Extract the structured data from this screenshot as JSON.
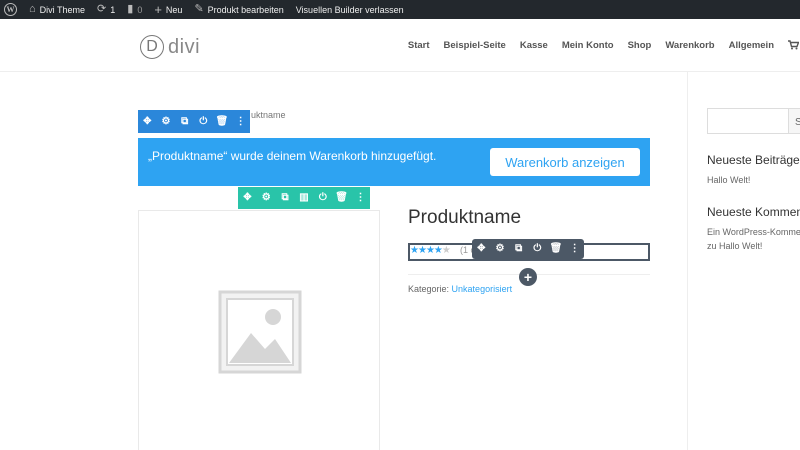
{
  "admin_bar": {
    "site_name": "Divi Theme",
    "updates_count": "1",
    "comments_count": "0",
    "new_label": "Neu",
    "edit_product_label": "Produkt bearbeiten",
    "exit_builder_label": "Visuellen Builder verlassen"
  },
  "header": {
    "logo_mark": "D",
    "logo_text": "divi",
    "nav": [
      "Start",
      "Beispiel-Seite",
      "Kasse",
      "Mein Konto",
      "Shop",
      "Warenkorb",
      "Allgemein"
    ]
  },
  "breadcrumb": "uktname",
  "notice": {
    "text": "„Produktname“ wurde deinem Warenkorb hinzugefügt.",
    "button_label": "Warenkorb anzeigen"
  },
  "product": {
    "title": "Produktname",
    "rating": 4,
    "rating_max": 5,
    "review_count_fragment": "(1 c",
    "category_label": "Kategorie:",
    "category_value": "Unkategorisiert"
  },
  "sidebar": {
    "search_button_fragment": "S",
    "recent_posts_title": "Neueste Beiträge",
    "recent_post_1": "Hallo Welt!",
    "recent_comments_title": "Neueste Kommentare",
    "recent_comment_line_1": "Ein WordPress-Kommentar",
    "recent_comment_line_2": "zu Hallo Welt!"
  },
  "colors": {
    "admin_bar": "#23282d",
    "divi_blue": "#2b87da",
    "notice_blue": "#2ea3f2",
    "divi_green": "#29c4a9",
    "divi_dark": "#4c5866"
  },
  "icons": {
    "module_tools": [
      "move-icon",
      "settings-icon",
      "duplicate-icon",
      "toggle-icon",
      "delete-icon",
      "more-icon"
    ],
    "row_tools": [
      "move-icon",
      "settings-icon",
      "duplicate-icon",
      "columns-icon",
      "toggle-icon",
      "delete-icon",
      "more-icon"
    ]
  }
}
